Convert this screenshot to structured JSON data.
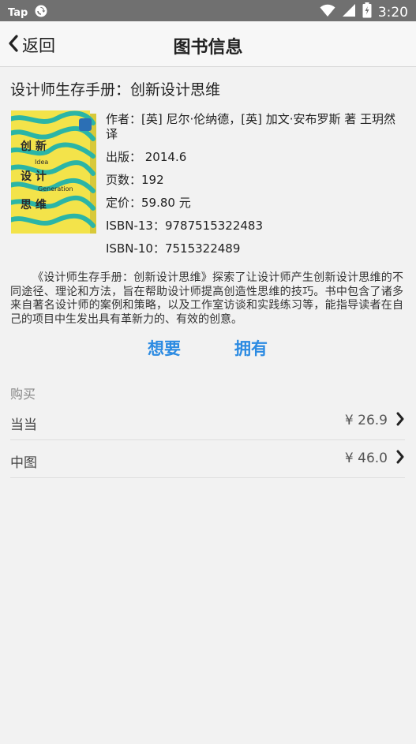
{
  "status_bar": {
    "left_text": "Tap",
    "time": "3:20"
  },
  "nav": {
    "back_label": "返回",
    "title": "图书信息"
  },
  "book": {
    "title": "设计师生存手册：创新设计思维",
    "cover": {
      "title_lines": [
        "创  新",
        "设  计",
        "思  维"
      ],
      "subtitle_lines": [
        "Idea",
        "Generation"
      ],
      "colors": {
        "background": "#f3e34a",
        "pattern": "#2bb5a6",
        "text": "#2b2b2b"
      }
    },
    "author": "作者：[英] 尼尔·伦纳德，[英] 加文·安布罗斯 著 王玥然 译",
    "published": "出版： 2014.6",
    "pages": "页数：192",
    "price": "定价：59.80 元",
    "isbn13": "ISBN-13：9787515322483",
    "isbn10": "ISBN-10：7515322489",
    "summary": "《设计师生存手册：创新设计思维》探索了让设计师产生创新设计思维的不同途径、理论和方法，旨在帮助设计师提高创造性思维的技巧。书中包含了诸多来自著名设计师的案例和策略，以及工作室访谈和实践练习等，能指导读者在自己的项目中生发出具有革新力的、有效的创意。"
  },
  "actions": {
    "want_label": "想要",
    "own_label": "拥有"
  },
  "purchase": {
    "section_label": "购买",
    "stores": [
      {
        "name": "当当",
        "price": "¥ 26.9"
      },
      {
        "name": "中图",
        "price": "¥ 46.0"
      }
    ]
  },
  "colors": {
    "accent": "#2c8be2",
    "status_bar": "#707070",
    "background": "#f2f2f2"
  },
  "icons": {
    "back": "chevron-left-icon",
    "store_link": "chevron-right-icon"
  }
}
